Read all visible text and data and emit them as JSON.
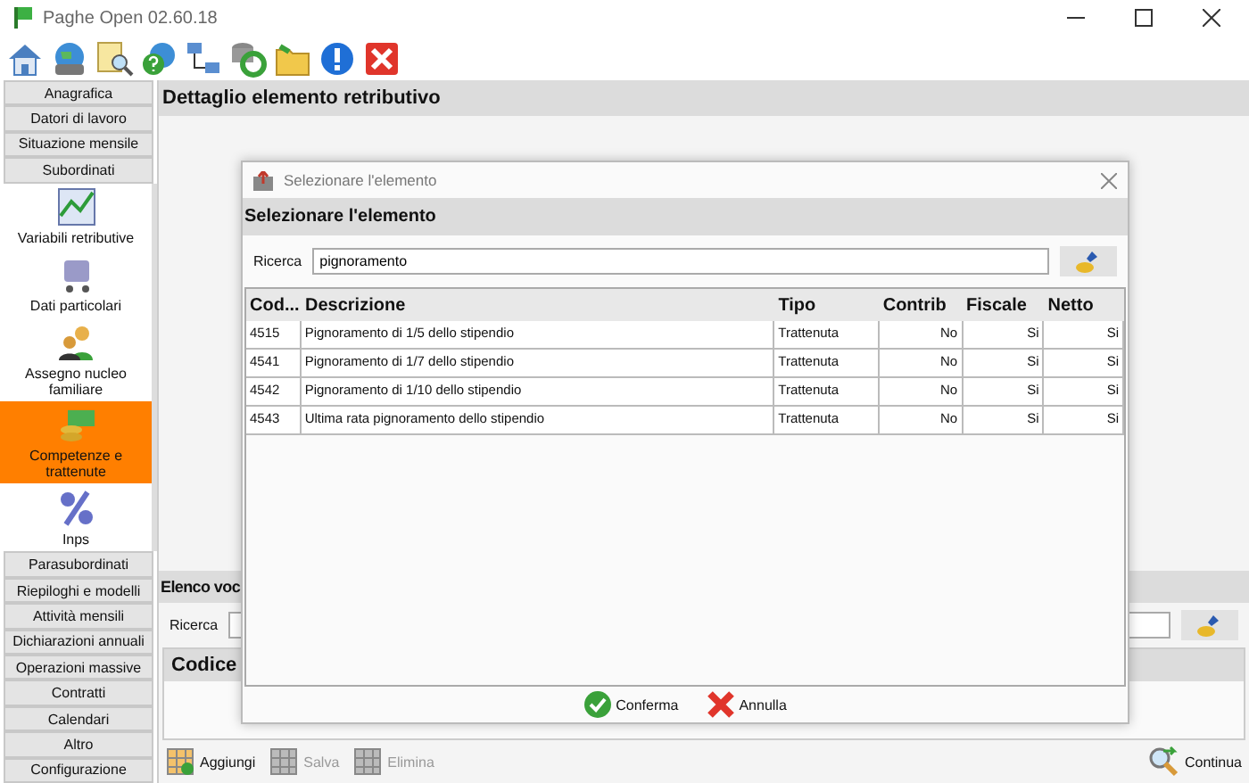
{
  "window": {
    "title": "Paghe Open 02.60.18"
  },
  "sidebar": {
    "top_sections": [
      {
        "label": "Anagrafica"
      },
      {
        "label": "Datori di lavoro"
      },
      {
        "label": "Situazione mensile"
      },
      {
        "label": "Subordinati"
      }
    ],
    "items": [
      {
        "label": "Variabili retributive",
        "selected": false
      },
      {
        "label": "Dati particolari",
        "selected": false
      },
      {
        "label": "Assegno nucleo familiare",
        "selected": false
      },
      {
        "label": "Competenze e trattenute",
        "selected": true
      },
      {
        "label": "Inps",
        "selected": false
      }
    ],
    "bottom_sections": [
      {
        "label": "Parasubordinati"
      },
      {
        "label": "Riepiloghi e modelli"
      },
      {
        "label": "Attività mensili"
      },
      {
        "label": "Dichiarazioni annuali"
      },
      {
        "label": "Operazioni massive"
      },
      {
        "label": "Contratti"
      },
      {
        "label": "Calendari"
      },
      {
        "label": "Altro"
      },
      {
        "label": "Configurazione"
      }
    ]
  },
  "main": {
    "detail_header": "Dettaglio elemento retributivo",
    "list_header": "Elenco voc",
    "search_label": "Ricerca",
    "code_header": "Codice",
    "toolbar": [
      {
        "label": "Aggiungi",
        "disabled": false
      },
      {
        "label": "Salva",
        "disabled": true
      },
      {
        "label": "Elimina",
        "disabled": true
      }
    ],
    "continue_button": "Continua"
  },
  "dialog": {
    "title": "Selezionare l'elemento",
    "header": "Selezionare l'elemento",
    "search_label": "Ricerca",
    "search_value": "pignoramento",
    "columns": [
      "Cod...",
      "Descrizione",
      "Tipo",
      "Contrib",
      "Fiscale",
      "Netto"
    ],
    "rows": [
      [
        "4515",
        "Pignoramento di 1/5 dello stipendio",
        "Trattenuta",
        "No",
        "Si",
        "Si"
      ],
      [
        "4541",
        "Pignoramento di 1/7 dello stipendio",
        "Trattenuta",
        "No",
        "Si",
        "Si"
      ],
      [
        "4542",
        "Pignoramento di 1/10 dello stipendio",
        "Trattenuta",
        "No",
        "Si",
        "Si"
      ],
      [
        "4543",
        "Ultima rata pignoramento dello stipendio",
        "Trattenuta",
        "No",
        "Si",
        "Si"
      ]
    ],
    "buttons": [
      {
        "label": "Conferma",
        "kind": "confirm"
      },
      {
        "label": "Annulla",
        "kind": "cancel"
      }
    ]
  }
}
